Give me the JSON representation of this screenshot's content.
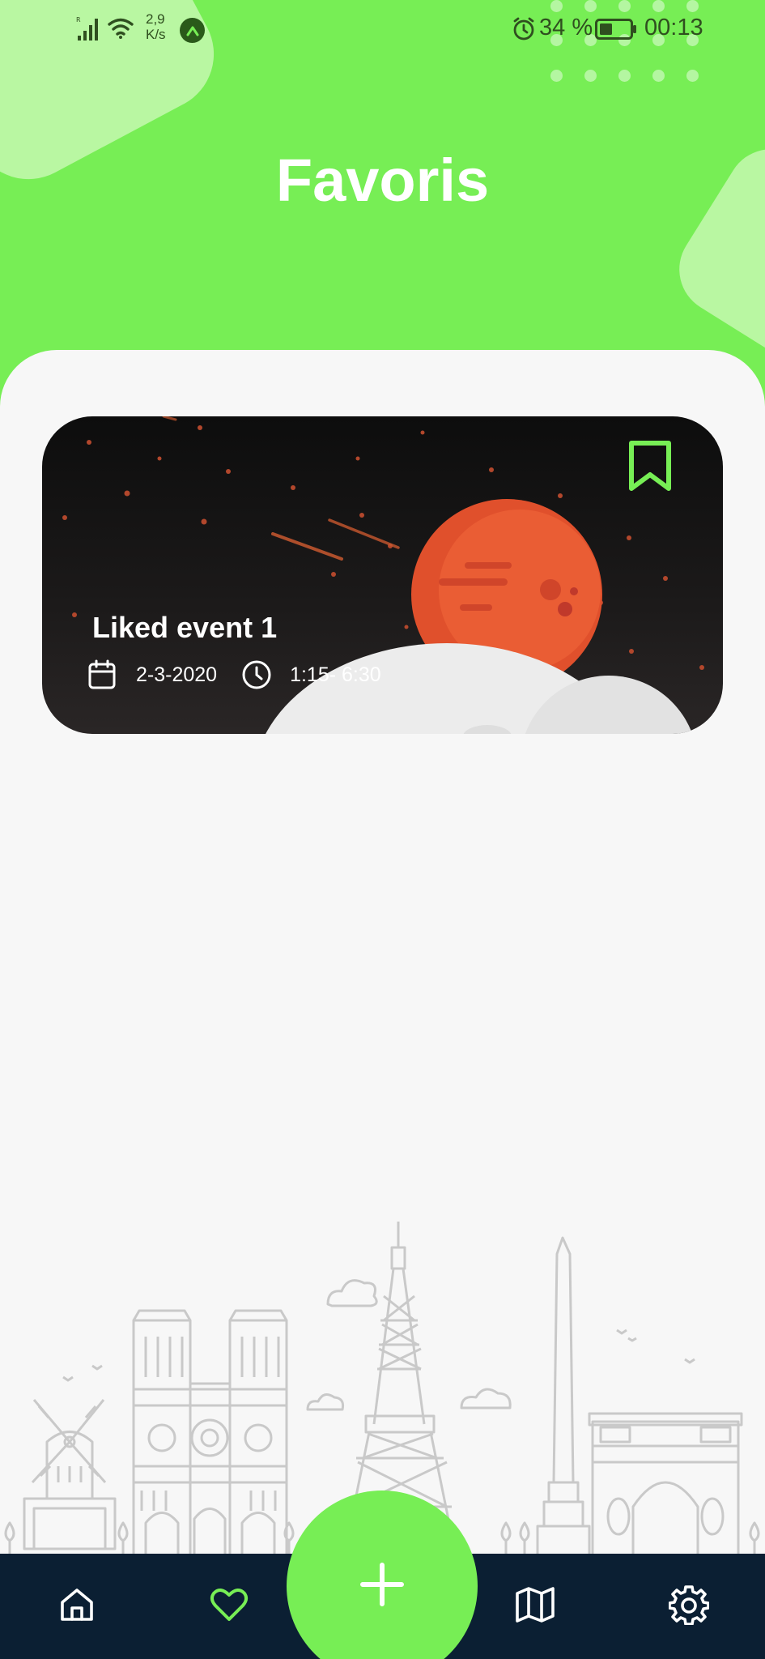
{
  "status_bar": {
    "network_speed_value": "2,9",
    "network_speed_unit": "K/s",
    "battery_percent": "34 %",
    "time": "00:13",
    "icons": [
      "signal-icon",
      "wifi-icon",
      "nearby-app-icon",
      "alarm-icon",
      "battery-icon"
    ]
  },
  "header": {
    "title": "Favoris"
  },
  "favorites": [
    {
      "title": "Liked event 1",
      "date": "2-3-2020",
      "time": "1:15- 6:30",
      "bookmark_icon": "bookmark-icon",
      "date_icon": "calendar-icon",
      "time_icon": "clock-icon"
    }
  ],
  "bottom_nav": {
    "items": [
      {
        "name": "home",
        "icon": "home-icon"
      },
      {
        "name": "favorites",
        "icon": "heart-icon",
        "active": true
      },
      {
        "name": "add",
        "icon": "plus-icon"
      },
      {
        "name": "map",
        "icon": "map-icon"
      },
      {
        "name": "settings",
        "icon": "gear-icon"
      }
    ]
  },
  "colors": {
    "accent": "#77ee55",
    "accent_light": "#b9f7a2",
    "nav_background": "#0b1f33",
    "content_background": "#f7f7f7"
  }
}
